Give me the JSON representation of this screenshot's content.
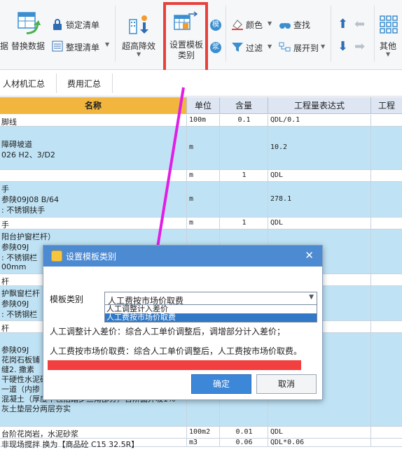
{
  "ribbon": {
    "partial_left_label": "据",
    "replace_data": "替换数据",
    "lock_list": "锁定清单",
    "organize_list": "整理清单",
    "super_reduce": "超高降效",
    "set_template_category": "设置模板\n类别",
    "mold_label": "模",
    "batch_label": "浆",
    "color": "颜色",
    "filter": "过滤",
    "find": "查找",
    "expand_to": "展开到",
    "other": "其他"
  },
  "tabs": [
    "人材机汇总",
    "费用汇总"
  ],
  "table": {
    "headers": {
      "name": "名称",
      "unit": "单位",
      "qty": "含量",
      "expr": "工程量表达式",
      "partial": "工程"
    },
    "rows": [
      {
        "style": "white",
        "h": 17,
        "name": [
          "脚线"
        ],
        "unit": "100m",
        "qty": "0.1",
        "expr": "QDL/0.1"
      },
      {
        "style": "blue",
        "h": 62,
        "name": [
          "",
          "障碍坡道",
          "026 H2、3/D2"
        ],
        "unit": "m",
        "qty": "",
        "expr": "10.2"
      },
      {
        "style": "white",
        "h": 17,
        "name": [
          ""
        ],
        "unit": "m",
        "qty": "1",
        "expr": "QDL"
      },
      {
        "style": "blue",
        "h": 51,
        "name": [
          "手",
          "  参陕09J08 B/64",
          ": 不锈钢扶手"
        ],
        "unit": "m",
        "qty": "",
        "expr": "278.1"
      },
      {
        "style": "white",
        "h": 17,
        "name": [
          "手"
        ],
        "unit": "m",
        "qty": "1",
        "expr": "QDL"
      },
      {
        "style": "blue",
        "h": 64,
        "name": [
          "阳台护窗栏杆）",
          "    参陕09J",
          ": 不锈钢栏",
          "00mm"
        ],
        "unit": "",
        "qty": "",
        "expr": ""
      },
      {
        "style": "white",
        "h": 17,
        "name": [
          "杆"
        ],
        "unit": "",
        "qty": "",
        "expr": ""
      },
      {
        "style": "blue",
        "h": 50,
        "name": [
          "护飘窗栏杆",
          "    参陕09J",
          ": 不锈钢栏"
        ],
        "unit": "",
        "qty": "",
        "expr": ""
      },
      {
        "style": "white",
        "h": 17,
        "name": [
          "杆"
        ],
        "unit": "",
        "qty": "",
        "expr": ""
      },
      {
        "style": "blue",
        "h": 134,
        "name": [
          "",
          "    参陕09J",
          "花岗石板铺",
          "缝2. 撒素",
          "干硬性水泥砂",
          "一道（内掺",
          "混凝土（厚度不包括踏步三角部分）台阶面外坡1%",
          "灰土垫层分两层夯实",
          ""
        ],
        "unit": "",
        "qty": "",
        "expr": ""
      },
      {
        "style": "white",
        "h": 17,
        "name": [
          "台阶花岗岩，水泥砂浆"
        ],
        "unit": "100m2",
        "qty": "0.01",
        "expr": "QDL"
      },
      {
        "style": "white",
        "h": 12,
        "name": [
          "  非现场搅拌  换为【商品砼 C15 32.5R】"
        ],
        "unit": "m3",
        "qty": "0.06",
        "expr": "QDL*0.06"
      }
    ]
  },
  "dialog": {
    "title": "设置模板类别",
    "template_label": "模板类别",
    "selected_value": "人工费按市场价取费",
    "options": [
      "人工调整计入差价",
      "人工费按市场价取费"
    ],
    "desc1": "人工调整计入差价：综合人工单价调整后，调增部分计入差价；",
    "desc2": "人工费按市场价取费：综合人工单价调整后，人工费按市场价取费。",
    "ok": "确定",
    "cancel": "取消"
  }
}
